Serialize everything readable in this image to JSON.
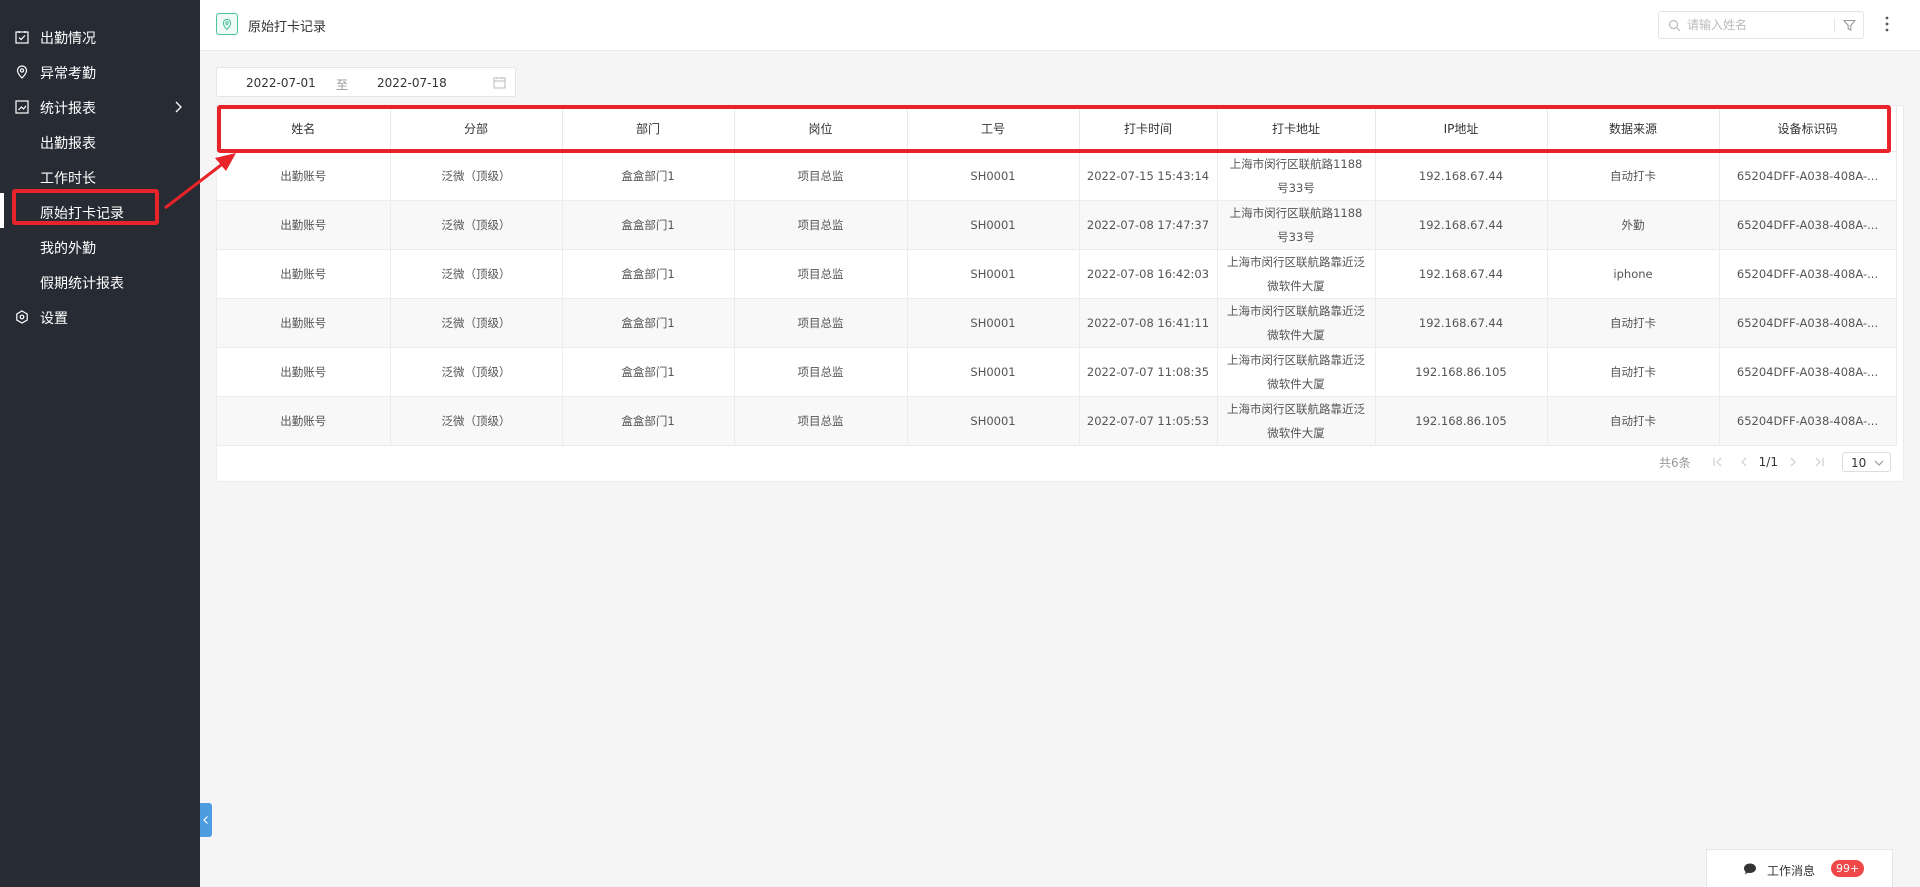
{
  "sidebar": {
    "items": [
      {
        "label": "出勤情况",
        "icon": "calendar-check-icon"
      },
      {
        "label": "异常考勤",
        "icon": "location-pin-icon"
      },
      {
        "label": "统计报表",
        "icon": "chart-report-icon"
      },
      {
        "label": "出勤报表"
      },
      {
        "label": "工作时长"
      },
      {
        "label": "原始打卡记录"
      },
      {
        "label": "我的外勤"
      },
      {
        "label": "假期统计报表"
      },
      {
        "label": "设置",
        "icon": "settings-icon"
      }
    ]
  },
  "header": {
    "title": "原始打卡记录",
    "search_placeholder": "请输入姓名"
  },
  "date_range": {
    "start": "2022-07-01",
    "separator": "至",
    "end": "2022-07-18"
  },
  "table": {
    "columns": [
      "姓名",
      "分部",
      "部门",
      "岗位",
      "工号",
      "打卡时间",
      "打卡地址",
      "IP地址",
      "数据来源",
      "设备标识码"
    ],
    "rows": [
      [
        "出勤账号",
        "泛微（顶级）",
        "盒盒部门1",
        "项目总监",
        "SH0001",
        "2022-07-15 15:43:14",
        "上海市闵行区联航路1188号33号",
        "192.168.67.44",
        "自动打卡",
        "65204DFF-A038-408A-..."
      ],
      [
        "出勤账号",
        "泛微（顶级）",
        "盒盒部门1",
        "项目总监",
        "SH0001",
        "2022-07-08 17:47:37",
        "上海市闵行区联航路1188号33号",
        "192.168.67.44",
        "外勤",
        "65204DFF-A038-408A-..."
      ],
      [
        "出勤账号",
        "泛微（顶级）",
        "盒盒部门1",
        "项目总监",
        "SH0001",
        "2022-07-08 16:42:03",
        "上海市闵行区联航路靠近泛微软件大厦",
        "192.168.67.44",
        "iphone",
        "65204DFF-A038-408A-..."
      ],
      [
        "出勤账号",
        "泛微（顶级）",
        "盒盒部门1",
        "项目总监",
        "SH0001",
        "2022-07-08 16:41:11",
        "上海市闵行区联航路靠近泛微软件大厦",
        "192.168.67.44",
        "自动打卡",
        "65204DFF-A038-408A-..."
      ],
      [
        "出勤账号",
        "泛微（顶级）",
        "盒盒部门1",
        "项目总监",
        "SH0001",
        "2022-07-07 11:08:35",
        "上海市闵行区联航路靠近泛微软件大厦",
        "192.168.86.105",
        "自动打卡",
        "65204DFF-A038-408A-..."
      ],
      [
        "出勤账号",
        "泛微（顶级）",
        "盒盒部门1",
        "项目总监",
        "SH0001",
        "2022-07-07 11:05:53",
        "上海市闵行区联航路靠近泛微软件大厦",
        "192.168.86.105",
        "自动打卡",
        "65204DFF-A038-408A-..."
      ]
    ]
  },
  "pagination": {
    "total": "共6条",
    "current": "1/1",
    "page_size": "10"
  },
  "messages": {
    "label": "工作消息",
    "badge": "99+"
  },
  "colors": {
    "sidebar_bg": "#272b33",
    "highlight_red": "#e8232a",
    "accent_green": "#4fc3a1",
    "badge_red": "#f04848",
    "collapse_tab_blue": "#4b9ce0"
  }
}
